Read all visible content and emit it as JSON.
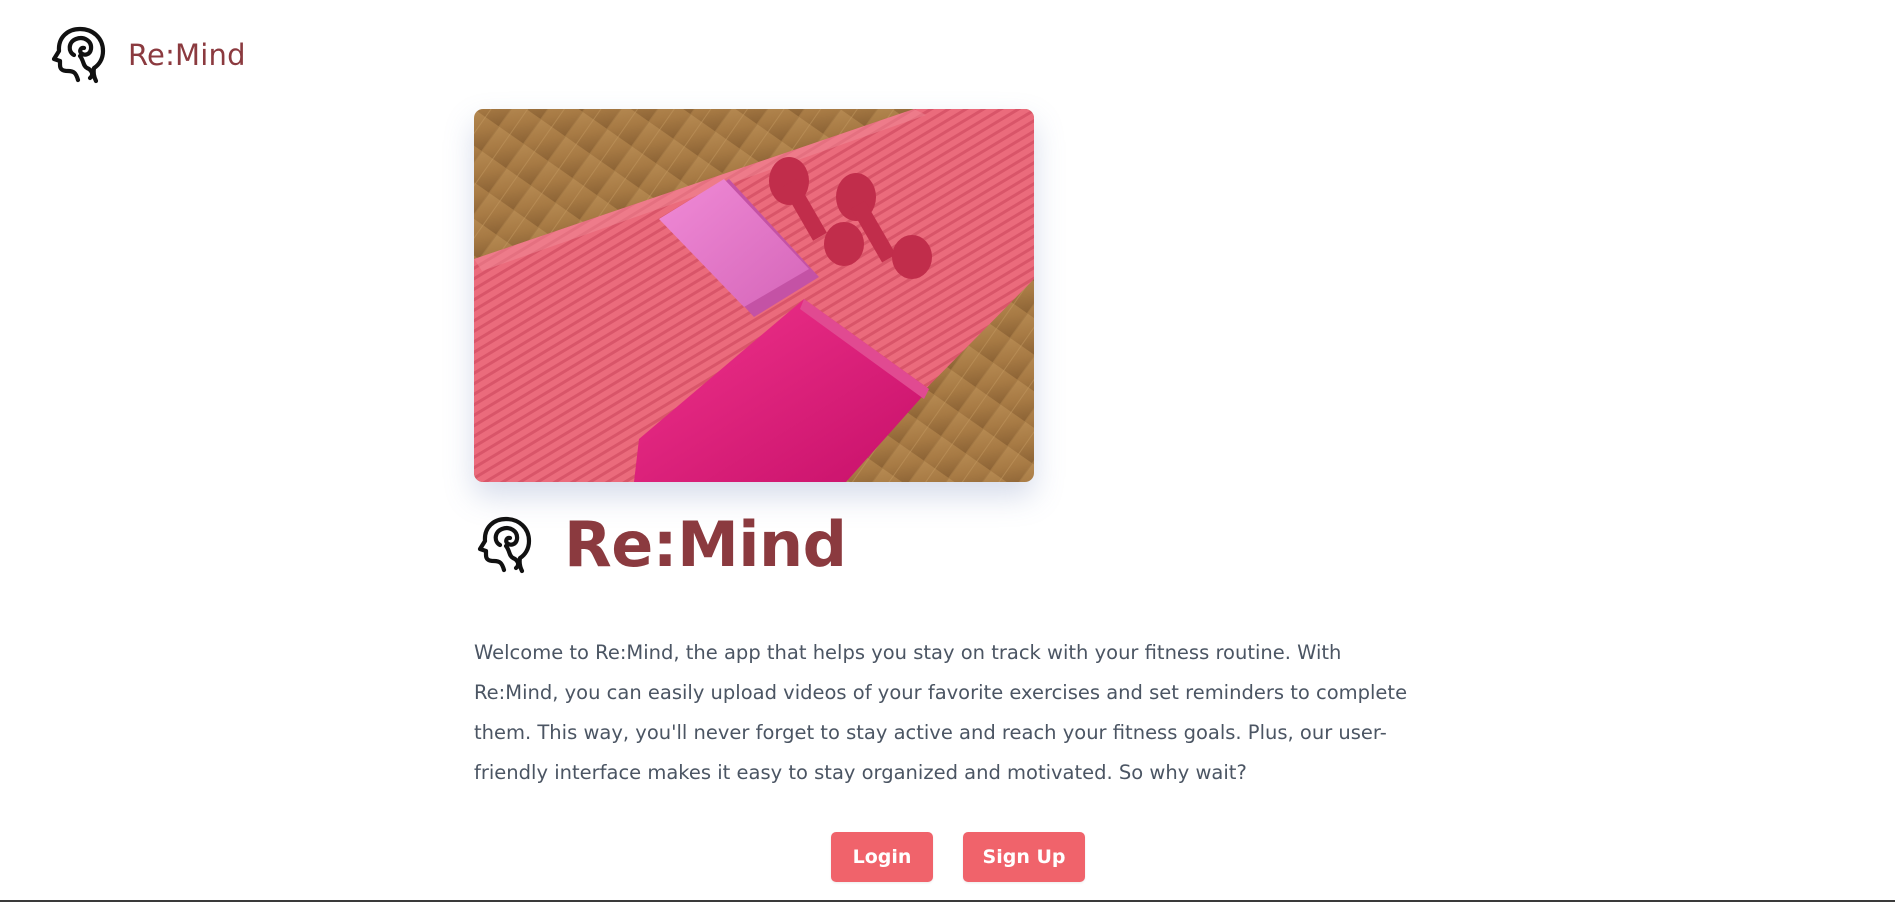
{
  "header": {
    "brand": "Re:Mind",
    "logo_icon": "head-brain-icon"
  },
  "hero": {
    "image_icon": "fitness-gear-photo",
    "description": "Pink exercise mat with yoga block, dumbbells and towel on wooden floor"
  },
  "main": {
    "title": "Re:Mind",
    "logo_icon": "head-brain-icon",
    "description": "Welcome to Re:Mind, the app that helps you stay on track with your fitness routine. With Re:Mind, you can easily upload videos of your favorite exercises and set reminders to complete them. This way, you'll never forget to stay active and reach your fitness goals. Plus, our user-friendly interface makes it easy to stay organized and motivated. So why wait?"
  },
  "actions": {
    "login_label": "Login",
    "signup_label": "Sign Up"
  },
  "colors": {
    "brand": "#8b3a3f",
    "button": "#f0636b",
    "text": "#4b5563"
  }
}
